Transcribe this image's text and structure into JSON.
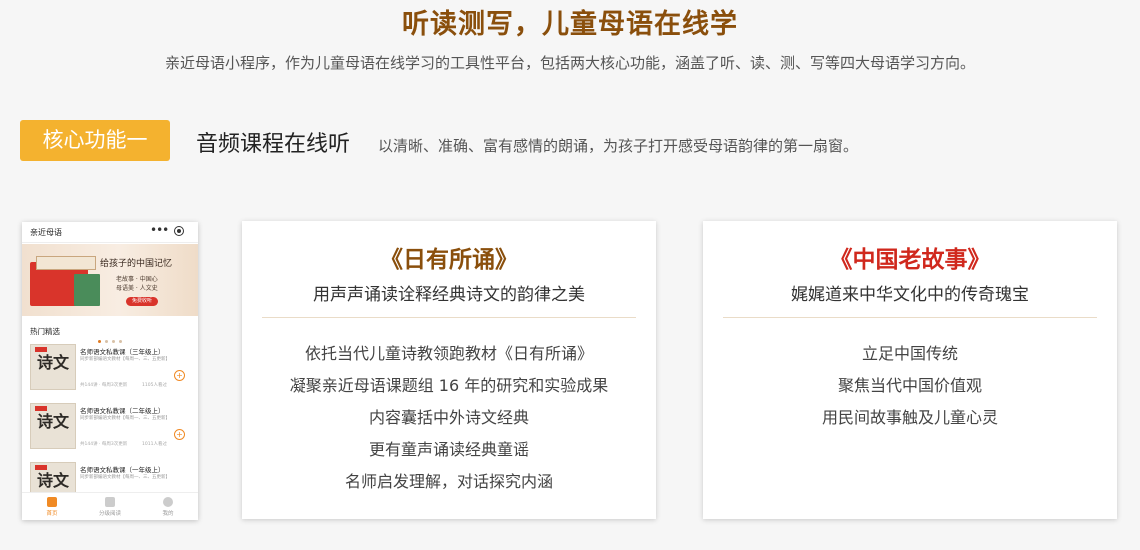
{
  "header": {
    "title": "听读测写，儿童母语在线学",
    "subtitle": "亲近母语小程序，作为儿童母语在线学习的工具性平台，包括两大核心功能，涵盖了听、读、测、写等四大母语学习方向。"
  },
  "feature": {
    "badge": "核心功能一",
    "title": "音频课程在线听",
    "desc": "以清晰、准确、富有感情的朗诵，为孩子打开感受母语韵律的第一扇窗。"
  },
  "phone": {
    "app_title": "亲近母语",
    "menu_icon": "more-dots-icon",
    "close_icon": "target-icon",
    "banner": {
      "slogan": "给孩子的中国记忆",
      "slogan2": "老故事 · 中国心",
      "slogan3": "母语美 · 人文史",
      "button": "免费收听"
    },
    "section_title": "热门精选",
    "items": [
      {
        "title": "名师语文私教课（三年级上）",
        "desc": "同步新部编语文教材【每周一、三、五更新】",
        "meta": "共144讲 · 每周3次更新",
        "count": "1105人看过",
        "thumb": "诗文"
      },
      {
        "title": "名师语文私教课（二年级上）",
        "desc": "同步新部编语文教材【每周一、三、五更新】",
        "meta": "共144讲 · 每周3次更新",
        "count": "1011人看过",
        "thumb": "诗文"
      },
      {
        "title": "名师语文私教课（一年级上）",
        "desc": "同步新部编语文教材【每周一、三、五更新】",
        "meta": "",
        "count": "",
        "thumb": "诗文"
      }
    ],
    "tabs": [
      {
        "label": "首页",
        "icon": "home-icon",
        "active": true
      },
      {
        "label": "分级阅读",
        "icon": "book-icon",
        "active": false
      },
      {
        "label": "我的",
        "icon": "user-icon",
        "active": false
      }
    ]
  },
  "cards": [
    {
      "title": "《日有所诵》",
      "title_color": "#8a4f0c",
      "subtitle": "用声声诵读诠释经典诗文的韵律之美",
      "lines": [
        "依托当代儿童诗教领跑教材《日有所诵》",
        "凝聚亲近母语课题组 16 年的研究和实验成果",
        "内容囊括中外诗文经典",
        "更有童声诵读经典童谣",
        "名师启发理解，对话探究内涵"
      ]
    },
    {
      "title": "《中国老故事》",
      "title_color": "#d0281d",
      "subtitle": "娓娓道来中华文化中的传奇瑰宝",
      "lines": [
        "立足中国传统",
        "聚焦当代中国价值观",
        "用民间故事触及儿童心灵"
      ]
    }
  ],
  "colors": {
    "accent": "#f4b22f",
    "brand_brown": "#8a4f0c",
    "brand_red": "#d0281d",
    "tab_active": "#f08a24"
  }
}
